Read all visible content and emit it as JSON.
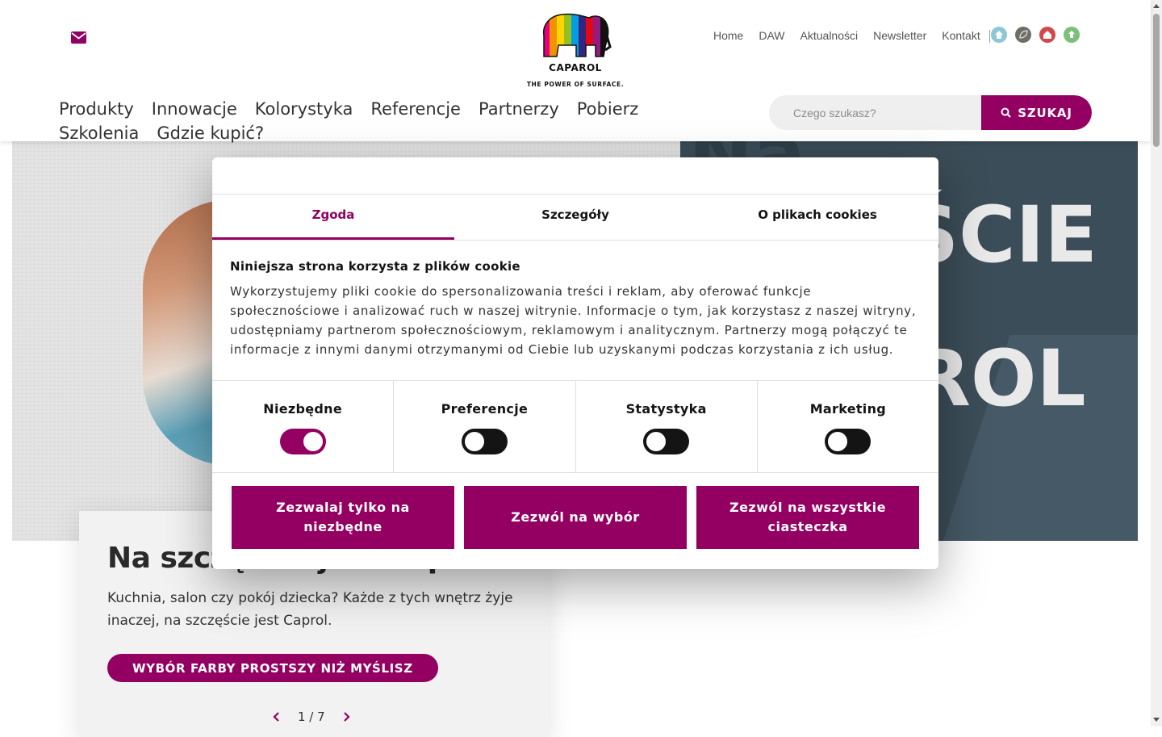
{
  "brand": {
    "name": "CAPAROL",
    "tagline": "THE POWER OF SURFACE.",
    "accent": "#940062"
  },
  "toplinks": [
    "Home",
    "DAW",
    "Aktualności",
    "Newsletter",
    "Kontakt"
  ],
  "circle_icons": [
    {
      "name": "home-circle-icon",
      "color": "#8cc6d8"
    },
    {
      "name": "leaf-circle-icon",
      "color": "#6e6e66"
    },
    {
      "name": "house-circle-icon",
      "color": "#d24848"
    },
    {
      "name": "eco-circle-icon",
      "color": "#7bbf7b"
    }
  ],
  "nav": [
    "Produkty",
    "Innowacje",
    "Kolorystyka",
    "Referencje",
    "Partnerzy",
    "Pobierz",
    "Szkolenia",
    "Gdzie kupić?"
  ],
  "search": {
    "placeholder": "Czego szukasz?",
    "button": "SZUKAJ"
  },
  "hero": {
    "big_text_1": "ŚCIE",
    "big_text_2": "ROL",
    "big_text_top": "Na",
    "card": {
      "title": "Na szczęście jest Caprol",
      "text": "Kuchnia, salon czy pokój dziecka? Każde z tych wnętrz żyje inaczej, na szczęście jest Caprol.",
      "button": "WYBÓR FARBY PROSTSZY NIŻ MYŚLISZ",
      "pager": "1 / 7"
    }
  },
  "cookie": {
    "tabs": [
      "Zgoda",
      "Szczegóły",
      "O plikach cookies"
    ],
    "active_tab": "Zgoda",
    "heading": "Niniejsza strona korzysta z plików cookie",
    "text": "Wykorzystujemy pliki cookie do spersonalizowania treści i reklam, aby oferować funkcje społecznościowe i analizować ruch w naszej witrynie. Informacje o tym, jak korzystasz z naszej witryny, udostępniamy partnerom społecznościowym, reklamowym i analitycznym. Partnerzy mogą połączyć te informacje z innymi danymi otrzymanymi od Ciebie lub uzyskanymi podczas korzystania z ich usług.",
    "toggles": [
      {
        "label": "Niezbędne",
        "on": true
      },
      {
        "label": "Preferencje",
        "on": false
      },
      {
        "label": "Statystyka",
        "on": false
      },
      {
        "label": "Marketing",
        "on": false
      }
    ],
    "buttons": [
      "Zezwalaj tylko na niezbędne",
      "Zezwól na wybór",
      "Zezwól na wszystkie ciasteczka"
    ]
  }
}
